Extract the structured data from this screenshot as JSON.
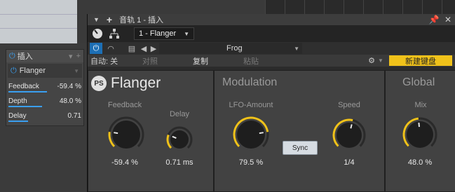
{
  "window": {
    "title": "音轨 1 - 插入",
    "pin_icon": "pin-icon",
    "close_icon": "close-icon"
  },
  "plugin_selector": {
    "value": "1 - Flanger"
  },
  "preset": {
    "value": "Frog"
  },
  "toolbar": {
    "automation": "自动: 关",
    "compare": "对照",
    "copy": "复制",
    "paste": "粘贴",
    "new_keyboard": "新建键盘"
  },
  "insert_panel": {
    "header": "插入",
    "device_name": "Flanger",
    "params": [
      {
        "name": "Feedback",
        "value": "-59.4 %",
        "level": 0.55
      },
      {
        "name": "Depth",
        "value": "48.0 %",
        "level": 0.48
      },
      {
        "name": "Delay",
        "value": "0.71",
        "level": 0.28
      }
    ]
  },
  "device": {
    "name": "Flanger",
    "logo_text": "PS",
    "sections": {
      "main": {
        "feedback": {
          "label": "Feedback",
          "value": "-59.4 %",
          "level": 0.2
        },
        "delay": {
          "label": "Delay",
          "value": "0.71 ms",
          "level": 0.25
        }
      },
      "modulation": {
        "title": "Modulation",
        "lfo_amount": {
          "label": "LFO-Amount",
          "value": "79.5 %",
          "level": 0.8
        },
        "sync": "Sync",
        "speed": {
          "label": "Speed",
          "value": "1/4",
          "level": 0.55
        }
      },
      "global": {
        "title": "Global",
        "mix": {
          "label": "Mix",
          "value": "48.0 %",
          "level": 0.48
        }
      }
    }
  },
  "colors": {
    "accent_blue": "#3a9ff0",
    "knob_arc": "#f0c21a",
    "new_keyboard_bg": "#f0c21a"
  }
}
